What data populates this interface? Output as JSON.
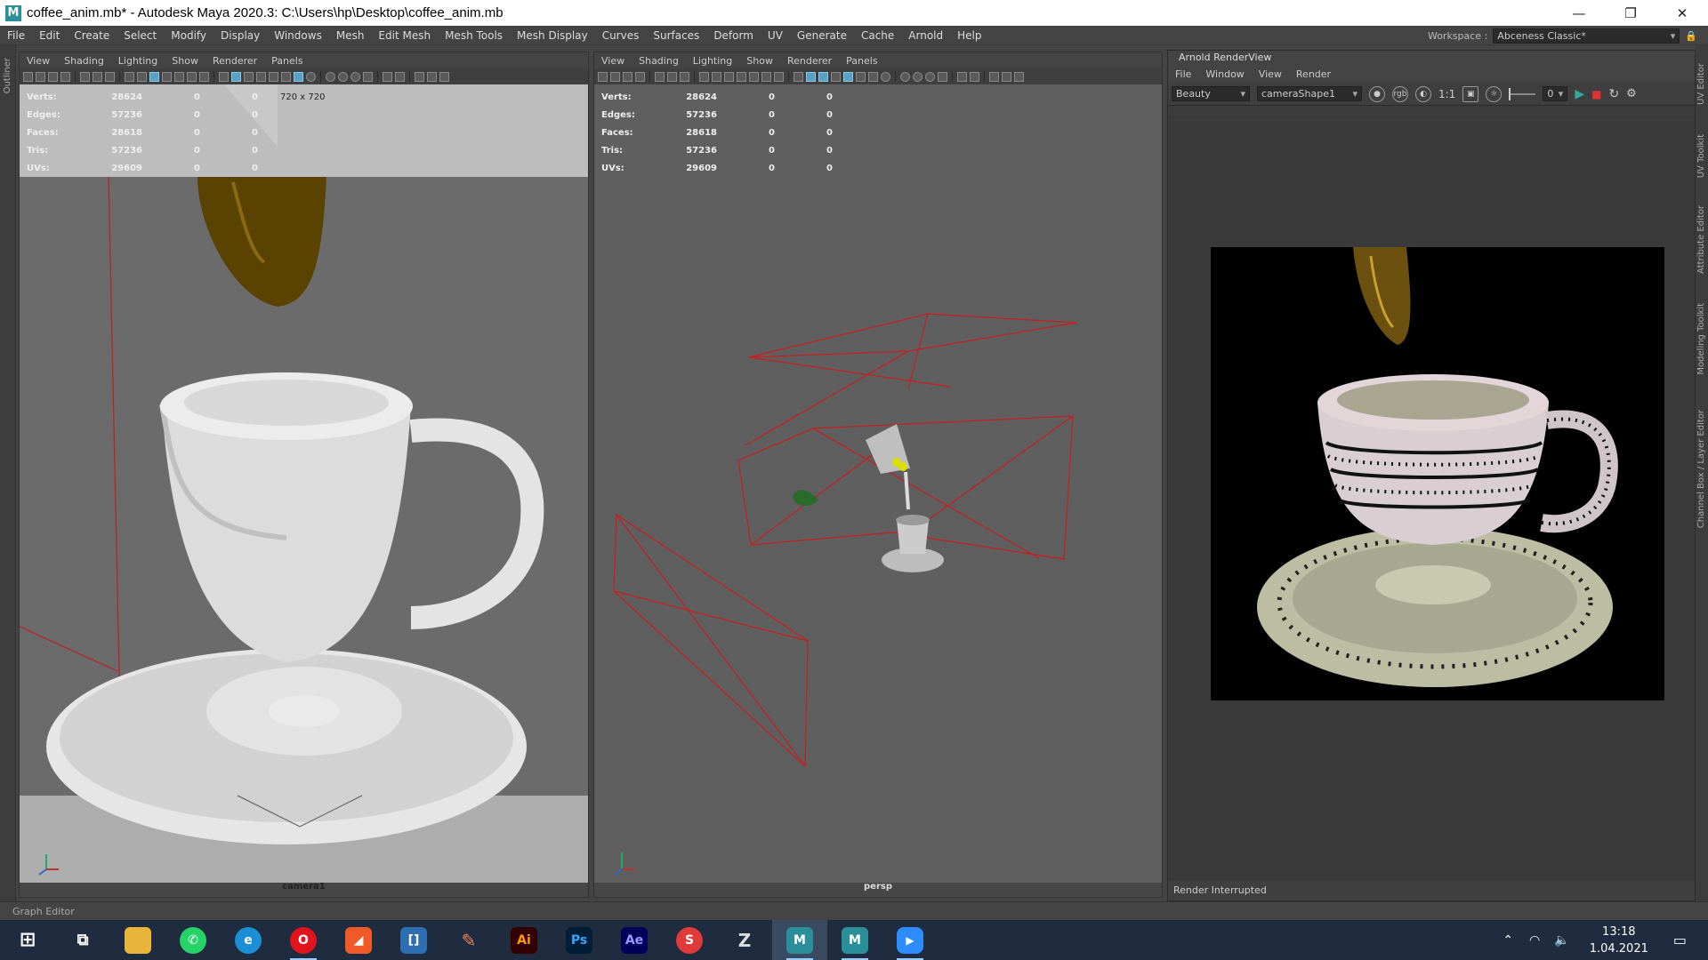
{
  "window": {
    "title": "coffee_anim.mb* - Autodesk Maya 2020.3: C:\\Users\\hp\\Desktop\\coffee_anim.mb",
    "app_icon": "M"
  },
  "menu": [
    "File",
    "Edit",
    "Create",
    "Select",
    "Modify",
    "Display",
    "Windows",
    "Mesh",
    "Edit Mesh",
    "Mesh Tools",
    "Mesh Display",
    "Curves",
    "Surfaces",
    "Deform",
    "UV",
    "Generate",
    "Cache",
    "Arnold",
    "Help"
  ],
  "workspace": {
    "label": "Workspace :",
    "value": "Abceness Classic*"
  },
  "outliner_label": "Outliner",
  "viewport_menu": [
    "View",
    "Shading",
    "Lighting",
    "Show",
    "Renderer",
    "Panels"
  ],
  "hud_rows": [
    {
      "k": "Verts:",
      "v": "28624",
      "a": "0",
      "b": "0"
    },
    {
      "k": "Edges:",
      "v": "57236",
      "a": "0",
      "b": "0"
    },
    {
      "k": "Faces:",
      "v": "28618",
      "a": "0",
      "b": "0"
    },
    {
      "k": "Tris:",
      "v": "57236",
      "a": "0",
      "b": "0"
    },
    {
      "k": "UVs:",
      "v": "29609",
      "a": "0",
      "b": "0"
    }
  ],
  "left_viewport": {
    "resolution": "720 x 720",
    "camera": "camera1"
  },
  "right_viewport": {
    "camera": "persp"
  },
  "arnold": {
    "title": "Arnold RenderView",
    "menu": [
      "File",
      "Window",
      "View",
      "Render"
    ],
    "aov": "Beauty",
    "camera": "cameraShape1",
    "ratio": "1:1",
    "exposure": "0",
    "status": "Render Interrupted"
  },
  "side_tabs": [
    "UV Editor",
    "UV Toolkit",
    "Attribute Editor",
    "Modeling Toolkit",
    "Channel Box / Layer Editor"
  ],
  "graph_editor": "Graph Editor",
  "taskbar": {
    "apps": [
      {
        "name": "windows-start",
        "label": "⊞",
        "color": "transparent"
      },
      {
        "name": "task-view",
        "label": "⧉",
        "color": "transparent"
      },
      {
        "name": "file-explorer",
        "label": "▬",
        "color": "#e8b53a"
      },
      {
        "name": "whatsapp",
        "label": "✆",
        "color": "#25d366"
      },
      {
        "name": "edge",
        "label": "e",
        "color": "#1b8fd6"
      },
      {
        "name": "opera",
        "label": "O",
        "color": "#e1131d"
      },
      {
        "name": "toolkit",
        "label": "◢",
        "color": "#f05a28"
      },
      {
        "name": "bracket-app",
        "label": "[]",
        "color": "#2d6fb0"
      },
      {
        "name": "pencil",
        "label": "✎",
        "color": "transparent"
      },
      {
        "name": "illustrator",
        "label": "Ai",
        "color": "#330000"
      },
      {
        "name": "photoshop",
        "label": "Ps",
        "color": "#001e36"
      },
      {
        "name": "after-effects",
        "label": "Ae",
        "color": "#00005b"
      },
      {
        "name": "substance",
        "label": "S",
        "color": "#e03a3a"
      },
      {
        "name": "zbrush",
        "label": "Z",
        "color": "transparent"
      },
      {
        "name": "maya-1",
        "label": "M",
        "color": "#2b8f9a"
      },
      {
        "name": "maya-2",
        "label": "M",
        "color": "#2b8f9a"
      },
      {
        "name": "zoom",
        "label": "▶",
        "color": "#2d8cff"
      }
    ],
    "time": "13:18",
    "date": "1.04.2021"
  }
}
